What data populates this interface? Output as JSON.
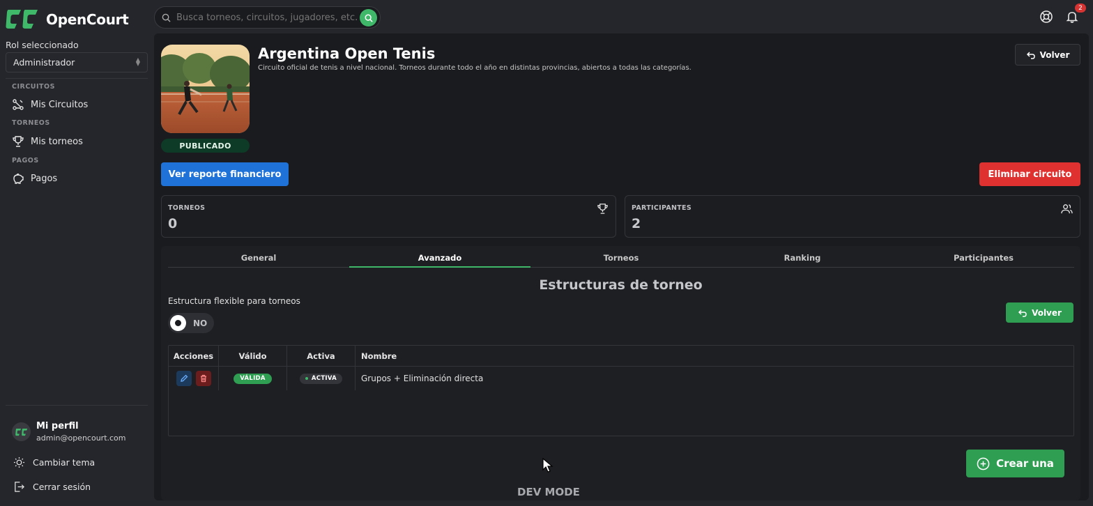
{
  "app": {
    "name": "OpenCourt"
  },
  "sidebar": {
    "role_label": "Rol seleccionado",
    "role_value": "Administrador",
    "sections": [
      {
        "title": "CIRCUITOS",
        "item": "Mis Circuitos"
      },
      {
        "title": "TORNEOS",
        "item": "Mis torneos"
      },
      {
        "title": "PAGOS",
        "item": "Pagos"
      }
    ],
    "profile": {
      "name": "Mi perfil",
      "email": "admin@opencourt.com"
    },
    "theme_label": "Cambiar tema",
    "logout_label": "Cerrar sesión"
  },
  "topbar": {
    "search_placeholder": "Busca torneos, circuitos, jugadores, etc.",
    "notification_count": "2"
  },
  "circuit": {
    "title": "Argentina Open Tenis",
    "description": "Circuito oficial de tenis a nivel nacional. Torneos durante todo el año en distintas provincias, abiertos a todas las categorías.",
    "status": "PUBLICADO",
    "back_label": "Volver",
    "report_label": "Ver reporte financiero",
    "delete_label": "Eliminar circuito"
  },
  "stats": [
    {
      "label": "TORNEOS",
      "value": "0",
      "icon": "trophy-icon"
    },
    {
      "label": "PARTICIPANTES",
      "value": "2",
      "icon": "users-icon"
    }
  ],
  "tabs": [
    "General",
    "Avanzado",
    "Torneos",
    "Ranking",
    "Participantes"
  ],
  "active_tab": "Avanzado",
  "advanced": {
    "section_title": "Estructuras de torneo",
    "flex_label": "Estructura flexible para torneos",
    "toggle_text": "NO",
    "back_label": "Volver",
    "table": {
      "headers": [
        "Acciones",
        "Válido",
        "Activa",
        "Nombre"
      ],
      "rows": [
        {
          "valid": "VÁLIDA",
          "active": "ACTIVA",
          "name": "Grupos + Eliminación directa"
        }
      ]
    },
    "create_label": "Crear una"
  },
  "dev_mode": "DEV MODE",
  "colors": {
    "accent": "#3fb86a",
    "primary": "#1f73d8",
    "danger": "#e03131",
    "background": "#1a1b1e"
  }
}
